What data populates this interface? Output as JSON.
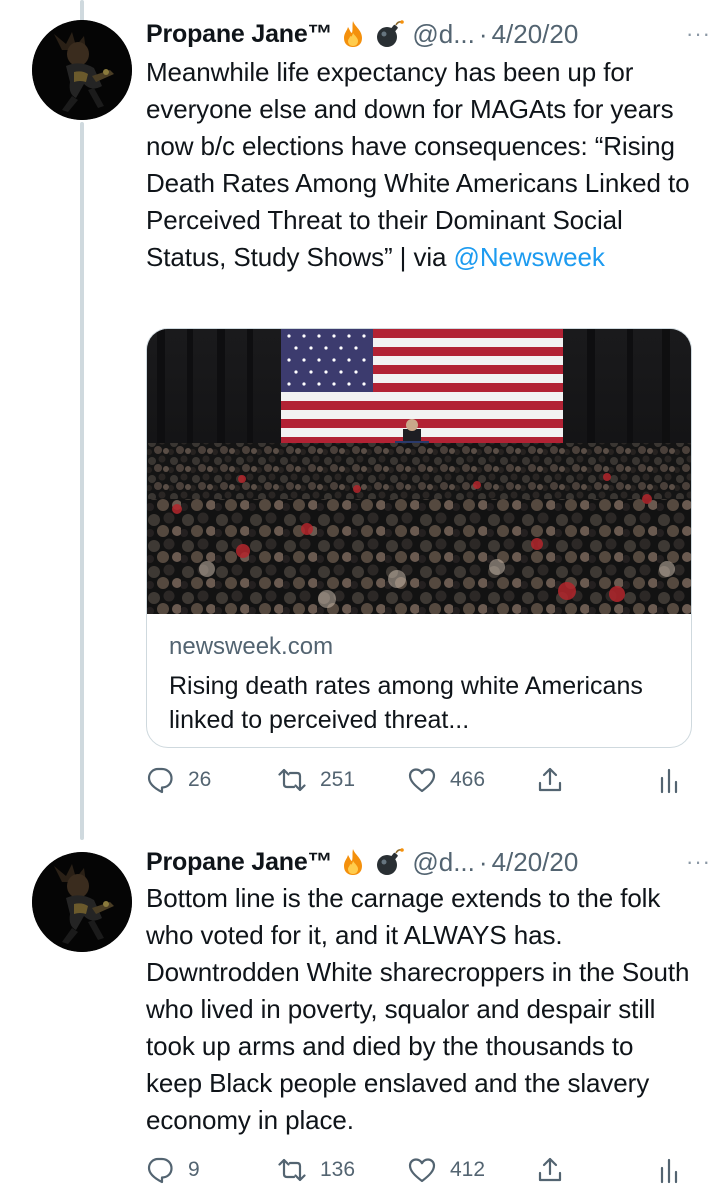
{
  "tweets": [
    {
      "author_name": "Propane Jane™",
      "emojis": [
        "fire-emoji",
        "bomb-emoji"
      ],
      "handle": "@d...",
      "separator": "·",
      "date": "4/20/20",
      "more": "···",
      "text": "Meanwhile life expectancy has been up for everyone else and down for MAGAts for years now b/c elections have consequences: “Rising Death Rates Among White Americans Linked to Perceived Threat to their Dominant Social Status, Study Shows” | via ",
      "mention": "@Newsweek",
      "card": {
        "domain": "newsweek.com",
        "title": "Rising death rates among white Americans linked to perceived threat..."
      },
      "actions": {
        "replies": "26",
        "retweets": "251",
        "likes": "466"
      }
    },
    {
      "author_name": "Propane Jane™",
      "emojis": [
        "fire-emoji",
        "bomb-emoji"
      ],
      "handle": "@d...",
      "separator": "·",
      "date": "4/20/20",
      "more": "···",
      "text": "Bottom line is the carnage extends to the folk who voted for it, and it ALWAYS has. Downtrodden White sharecroppers in the South who lived in poverty, squalor and despair still took up arms and died by the thousands to keep Black people enslaved and the slavery economy in place.",
      "actions": {
        "replies": "9",
        "retweets": "136",
        "likes": "412"
      }
    }
  ],
  "colors": {
    "accent": "#1d9bf0",
    "secondary_text": "#536471",
    "thread_line": "#cfd9de",
    "border": "#cfd9de"
  }
}
